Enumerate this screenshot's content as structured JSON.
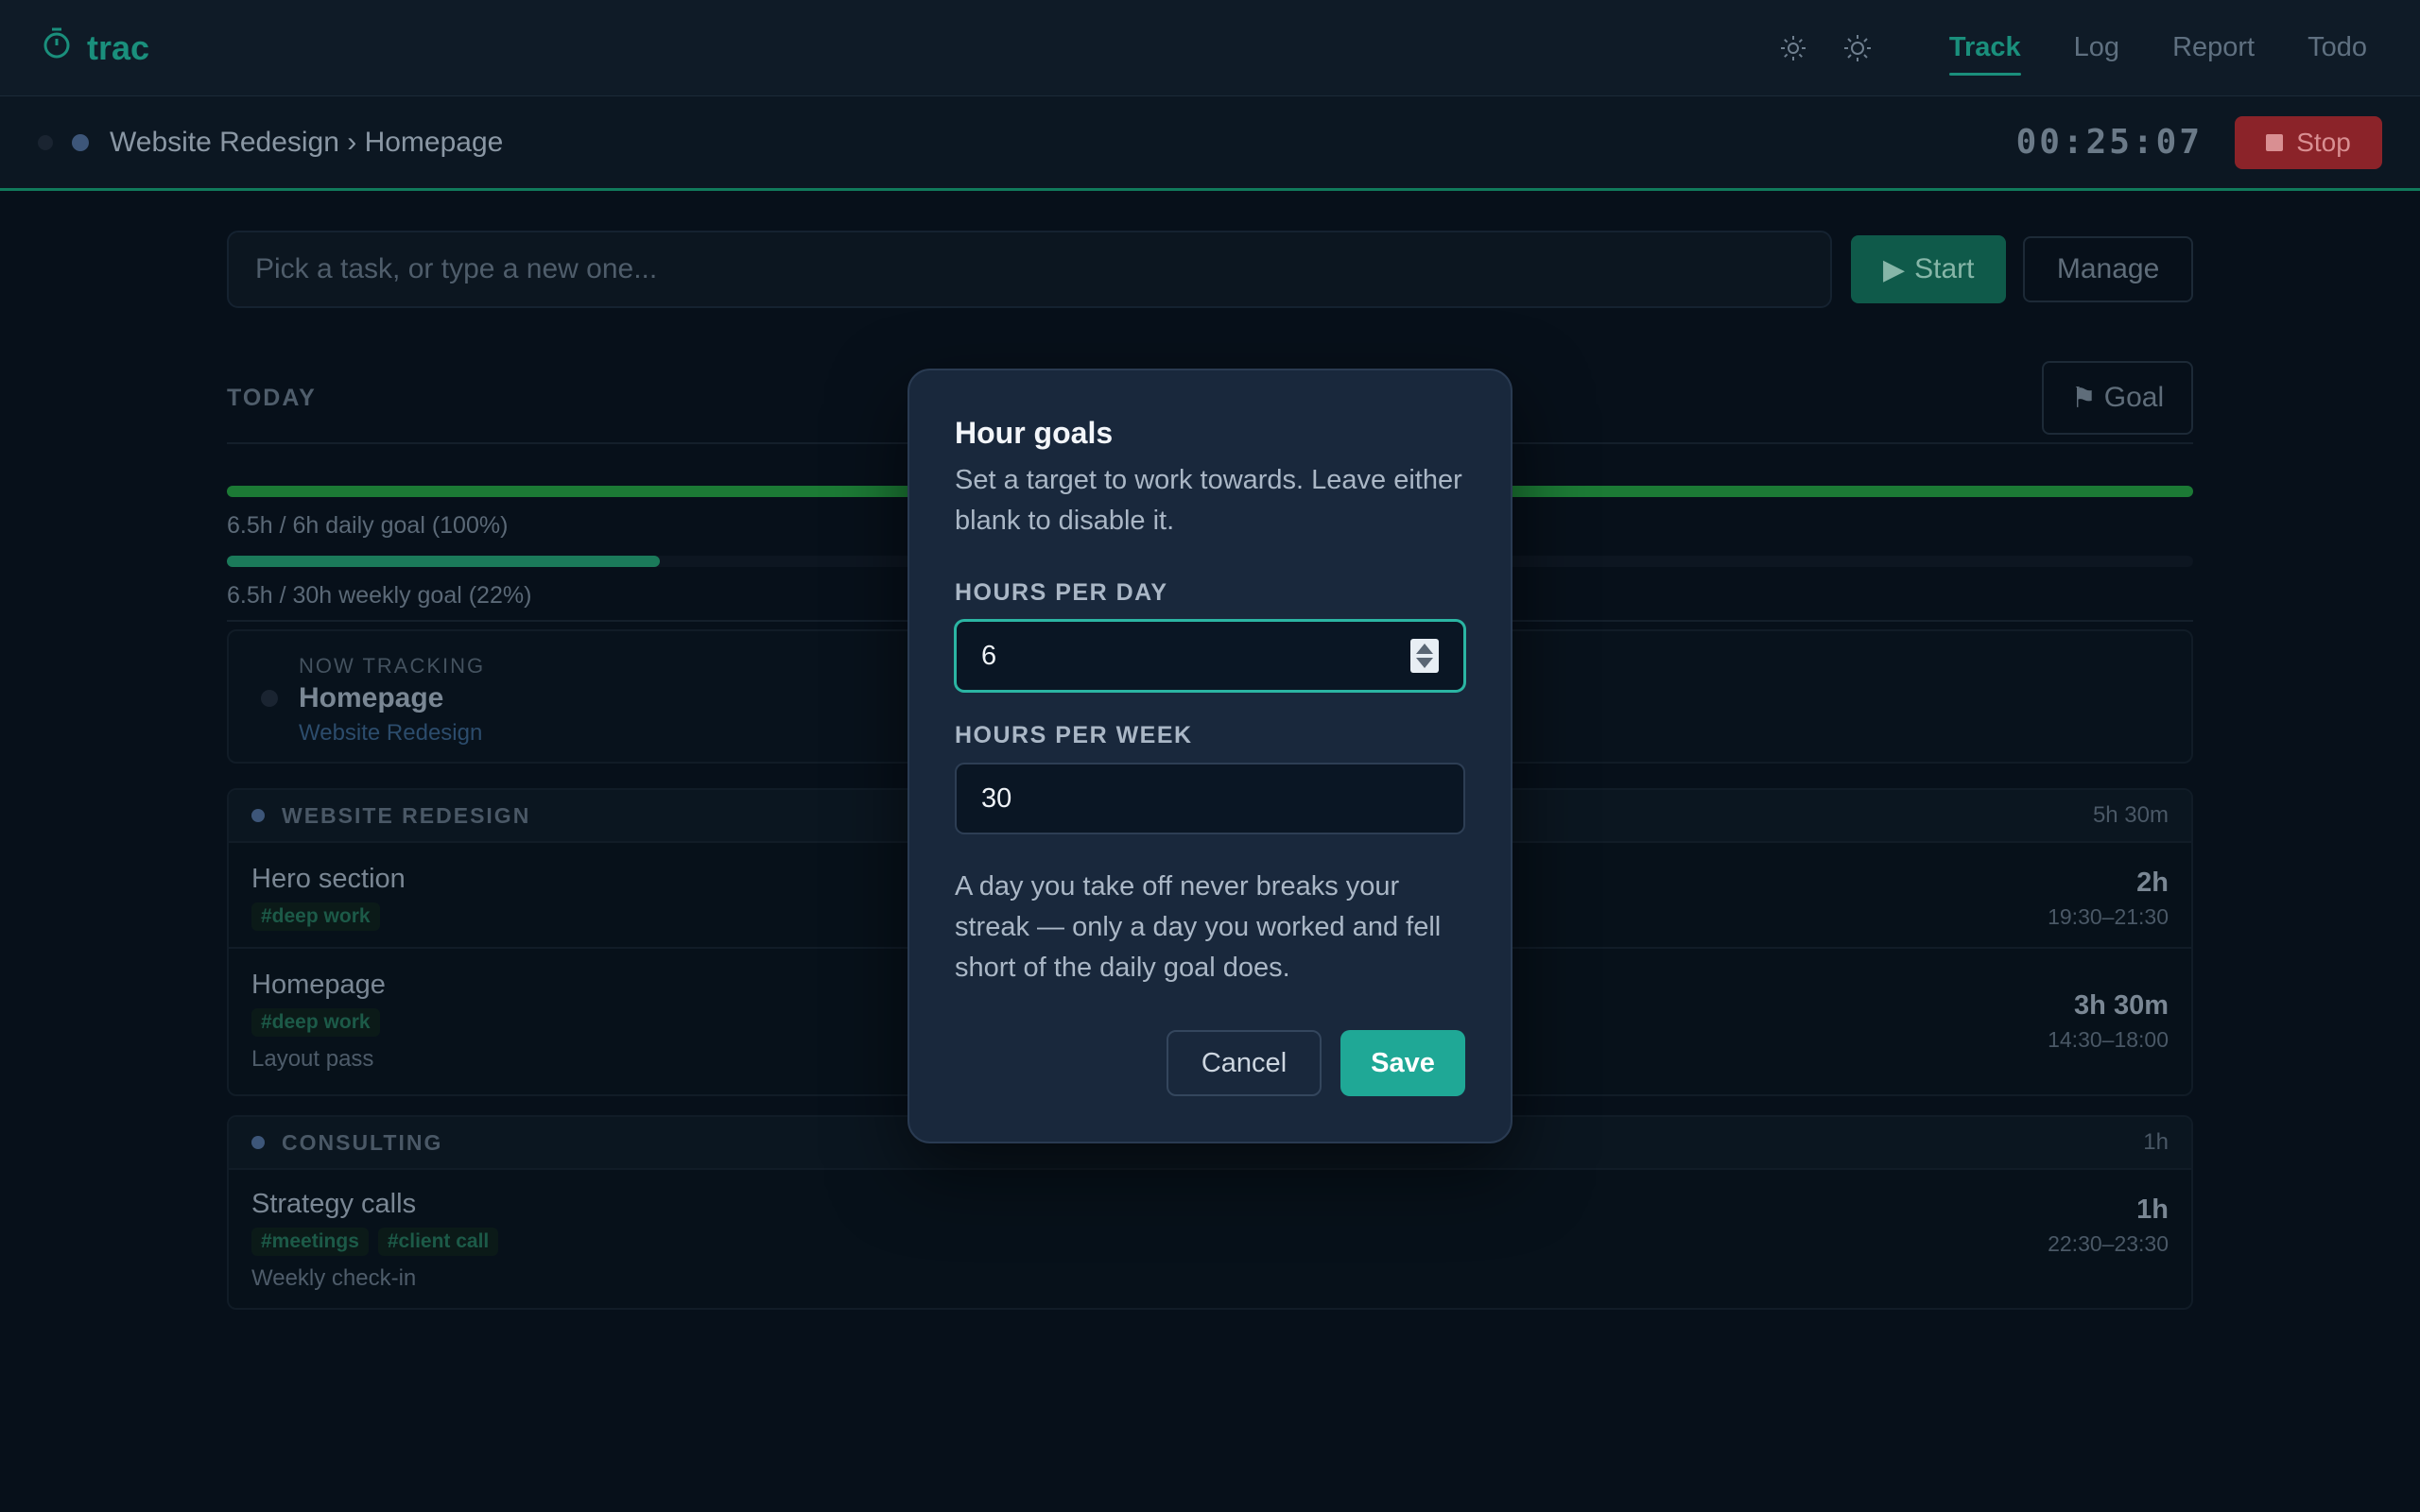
{
  "app": {
    "name": "trac",
    "accent_color": "#1a8f7c"
  },
  "nav": {
    "theme_icons": [
      "sun-icon",
      "sun-outline-icon"
    ],
    "links": [
      "Track",
      "Log",
      "Report",
      "Todo"
    ],
    "active": "Track"
  },
  "tracking": {
    "path": "Website Redesign › Homepage",
    "timer": "00:25:07",
    "stop_label": "Stop",
    "stop_color": "#8b2329"
  },
  "task_bar": {
    "placeholder": "Pick a task, or type a new one...",
    "start_label": "Start",
    "manage_label": "Manage"
  },
  "today": {
    "label": "TODAY",
    "goal_button": "Goal",
    "daily_goal": {
      "text": "6.5h / 6h daily goal (100%)",
      "fraction": 1.0
    },
    "weekly_goal": {
      "text": "6.5h / 30h weekly goal (22%)",
      "fraction": 0.22
    }
  },
  "now_tracking": {
    "kicker": "NOW TRACKING",
    "task": "Homepage",
    "project": "Website Redesign"
  },
  "groups": [
    {
      "name": "WEBSITE REDESIGN",
      "total": "5h 30m",
      "entries": [
        {
          "title": "Hero section",
          "tags": [
            "#deep work"
          ],
          "note": "",
          "duration": "2h",
          "range": "19:30–21:30"
        },
        {
          "title": "Homepage",
          "tags": [
            "#deep work"
          ],
          "note": "Layout pass",
          "duration": "3h 30m",
          "range": "14:30–18:00"
        }
      ]
    },
    {
      "name": "CONSULTING",
      "total": "1h",
      "entries": [
        {
          "title": "Strategy calls",
          "tags": [
            "#meetings",
            "#client call"
          ],
          "note": "Weekly check-in",
          "duration": "1h",
          "range": "22:30–23:30"
        }
      ]
    }
  ],
  "modal": {
    "title": "Hour goals",
    "description": "Set a target to work towards. Leave either blank to disable it.",
    "day_label": "HOURS PER DAY",
    "day_value": "6",
    "week_label": "HOURS PER WEEK",
    "week_value": "30",
    "note": "A day you take off never breaks your streak — only a day you worked and fell short of the daily goal does.",
    "cancel_label": "Cancel",
    "save_label": "Save",
    "save_color": "#1fa896"
  }
}
